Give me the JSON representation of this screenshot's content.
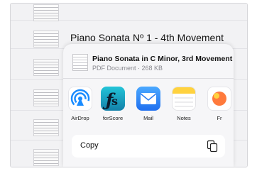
{
  "background_list": {
    "visible_title": "Piano Sonata Nº 1 - 4th Movement"
  },
  "share_sheet": {
    "file": {
      "title": "Piano Sonata in C Minor, 3rd Movement",
      "meta": "PDF Document · 268 KB"
    },
    "apps": [
      {
        "label": "AirDrop",
        "icon": "airdrop-icon",
        "color": "#1a8cff"
      },
      {
        "label": "forScore",
        "icon": "forscore-icon",
        "color": "#1aa9c9"
      },
      {
        "label": "Mail",
        "icon": "mail-icon",
        "color": "#2f8cff"
      },
      {
        "label": "Notes",
        "icon": "notes-icon",
        "color": "#ffd23f"
      },
      {
        "label": "Fr",
        "icon": "freeform-icon",
        "color": "#ff7a3c"
      }
    ],
    "actions": [
      {
        "label": "Copy",
        "icon": "copy-icon"
      }
    ]
  }
}
